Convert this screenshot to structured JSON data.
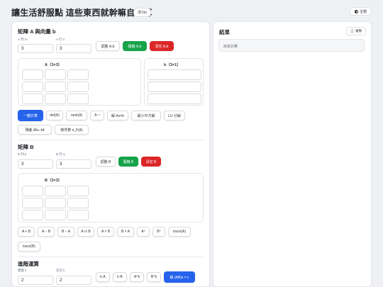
{
  "header": {
    "title": "讓生活舒服點 這些東西就幹嘛自己算",
    "badge": "僅Tab",
    "theme_label": "主題"
  },
  "matrix_a": {
    "title": "矩陣 A 與向量 b",
    "rows_label": "A 列 m",
    "cols_label": "A 行 n",
    "rows_value": "3",
    "cols_value": "3",
    "resize_label": "調整 A,b",
    "random_label": "隨機 A,b",
    "clear_label": "清空 A,b",
    "grid_title": "A（3×3）",
    "vector_title": "b（3×1）",
    "ops": [
      "一鍵計算",
      "det(A)",
      "rank(A)",
      "A⁻¹",
      "解 Ax=b",
      "最小平方解",
      "LU 分解",
      "殘差 ‖Ax−b‖",
      "條件數 κ_F(A)"
    ]
  },
  "matrix_b": {
    "title": "矩陣 B",
    "rows_label": "B 列 p",
    "cols_label": "B 行 q",
    "rows_value": "3",
    "cols_value": "3",
    "resize_label": "調整 B",
    "random_label": "隨機 B",
    "clear_label": "清空 B",
    "grid_title": "B（3×3）",
    "ops": [
      "A + B",
      "A − B",
      "B − A",
      "A ⊙ B",
      "A × B",
      "B × A",
      "Aᵀ",
      "Bᵀ",
      "trace(A)",
      "trace(B)"
    ]
  },
  "advanced": {
    "title": "進階運算",
    "scalar_label": "標量 k",
    "power_label": "次方 k",
    "scalar_value": "2",
    "power_value": "2",
    "ops": [
      "k·A",
      "k·B",
      "A^k",
      "B^k",
      "解 (AB)x = c"
    ]
  },
  "result": {
    "title": "結果",
    "copy_label": "複製",
    "placeholder": "尚未計算"
  }
}
